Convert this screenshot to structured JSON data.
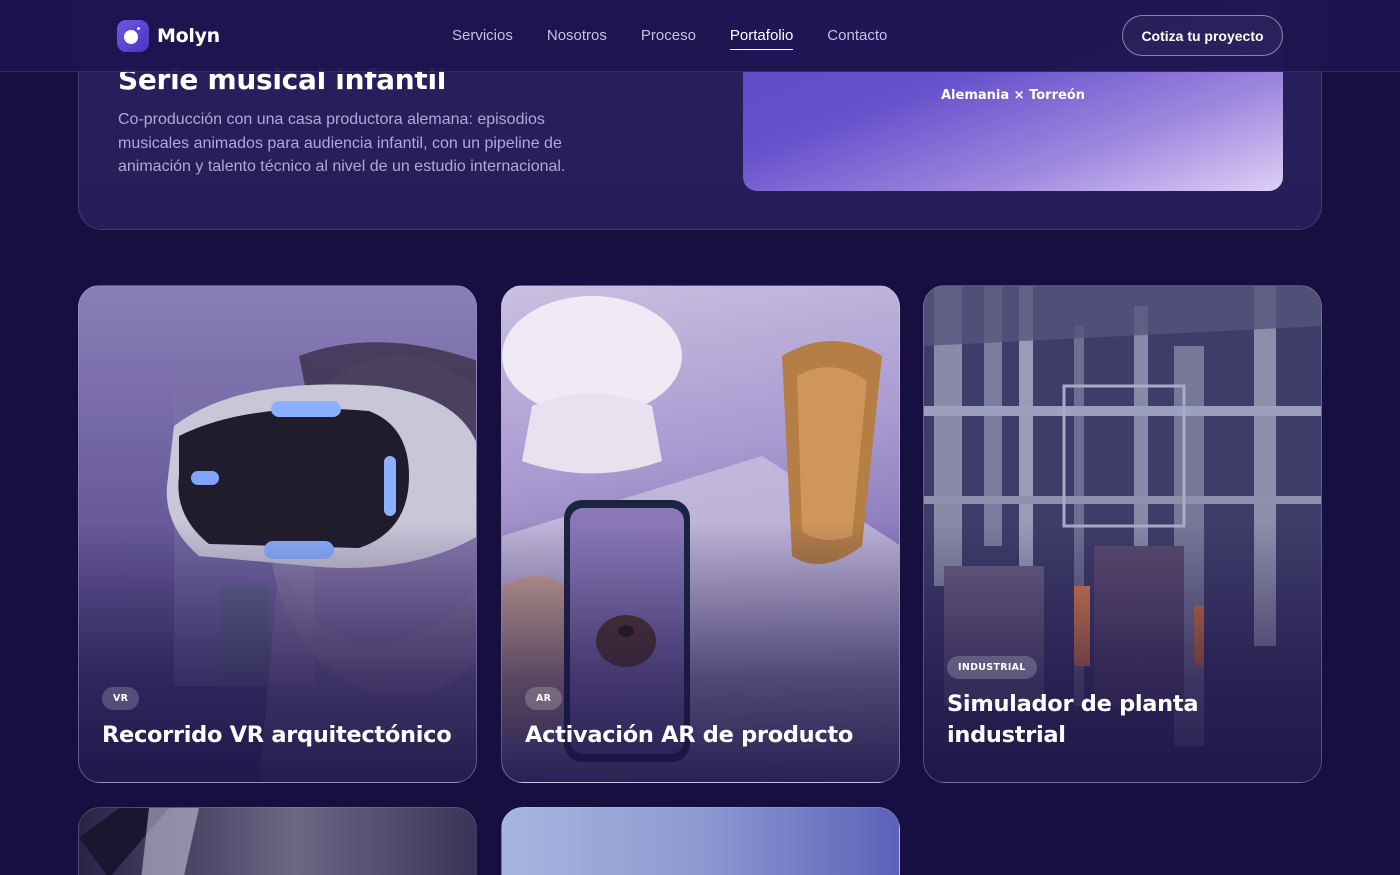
{
  "brand": {
    "name": "Molyn"
  },
  "nav": {
    "items": [
      {
        "label": "Servicios"
      },
      {
        "label": "Nosotros"
      },
      {
        "label": "Proceso"
      },
      {
        "label": "Portafolio",
        "active": true
      },
      {
        "label": "Contacto"
      }
    ],
    "cta_label": "Cotiza tu proyecto"
  },
  "featured": {
    "title": "Serie musical infantil",
    "description": "Co-producción con una casa productora alemana: episodios musicales animados para audiencia infantil, con un pipeline de animación y talento técnico al nivel de un estudio internacional.",
    "caption": "Alemania × Torreón"
  },
  "projects": [
    {
      "tag": "VR",
      "title": "Recorrido VR arquitectónico"
    },
    {
      "tag": "AR",
      "title": "Activación AR de producto"
    },
    {
      "tag": "INDUSTRIAL",
      "title": "Simulador de planta industrial"
    }
  ],
  "colors": {
    "background": "#170f3f",
    "header": "#1e1450",
    "accent": "#6f57e6",
    "text_muted": "#b0a9d6"
  }
}
